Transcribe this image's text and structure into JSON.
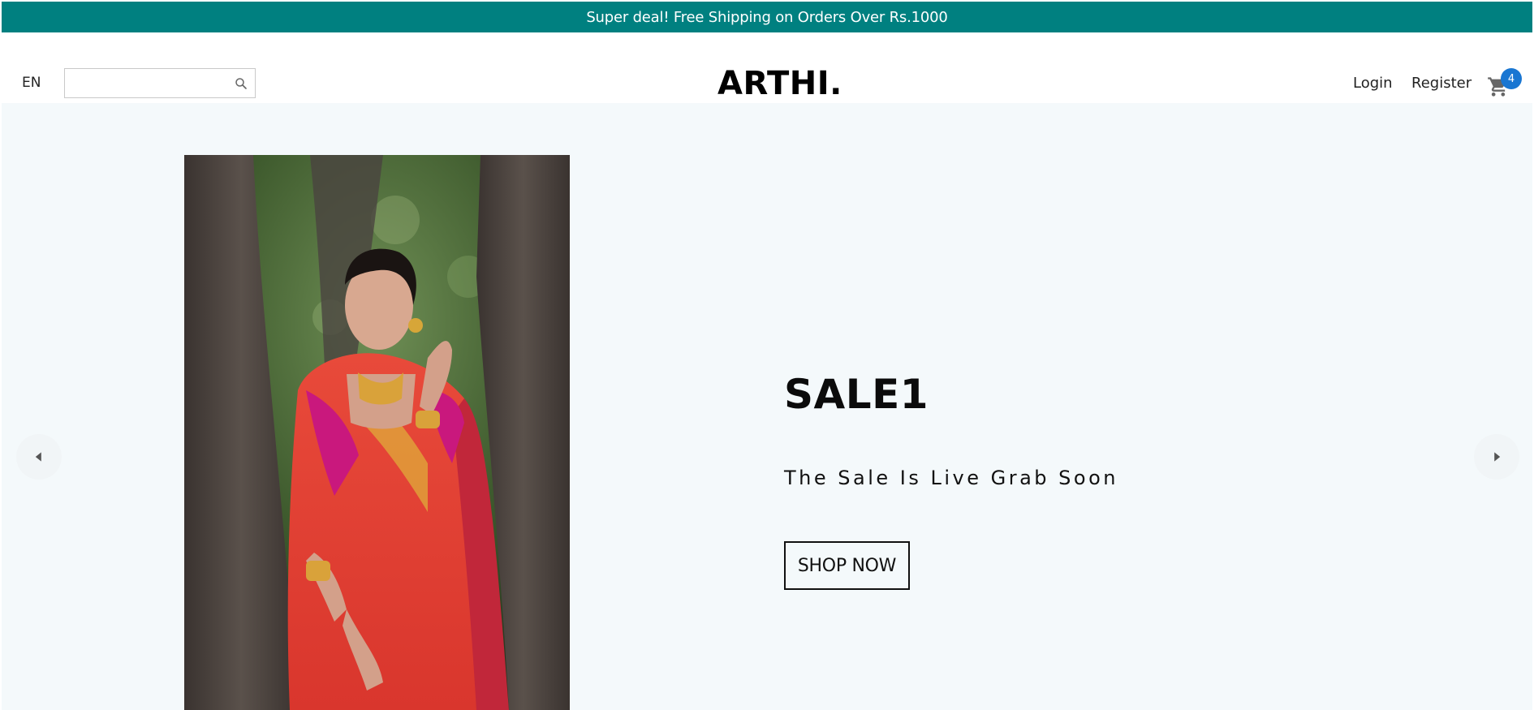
{
  "announcement": {
    "text": "Super deal! Free Shipping on Orders Over Rs.1000"
  },
  "navbar": {
    "language": "EN",
    "search": {
      "value": "",
      "placeholder": ""
    },
    "logo": "ARTHI.",
    "links": {
      "login": "Login",
      "register": "Register"
    },
    "cart": {
      "count": "4",
      "badge_color": "#1976d2"
    }
  },
  "slider": {
    "slide": {
      "title": "SALE1",
      "description": "The Sale Is Live Grab Soon",
      "button_label": "SHOP NOW",
      "image": "woman-in-saree-photo"
    }
  },
  "icons": {
    "search": "search-icon",
    "cart": "cart-icon",
    "prev": "chevron-left-icon",
    "next": "chevron-right-icon"
  },
  "colors": {
    "announcement_bg": "#008080",
    "slider_bg": "#f4f9fb",
    "badge": "#1976d2"
  }
}
